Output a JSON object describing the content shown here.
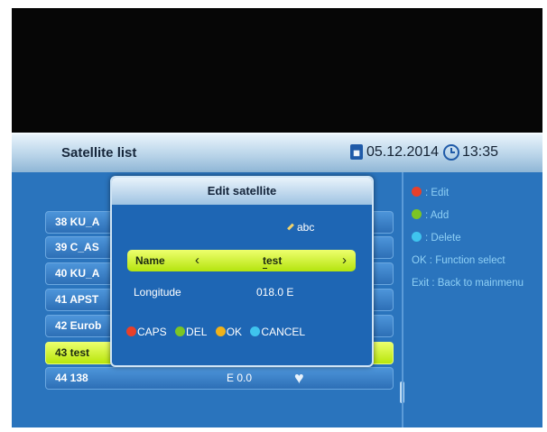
{
  "header": {
    "title": "Satellite list",
    "date": "05.12.2014",
    "time": "13:35"
  },
  "satellite_list": {
    "rows": [
      {
        "label": "38 KU_A",
        "position": ""
      },
      {
        "label": "39 C_AS",
        "position": ""
      },
      {
        "label": "40 KU_A",
        "position": ""
      },
      {
        "label": "41 APST",
        "position": ""
      },
      {
        "label": "42 Eurob",
        "position": ""
      },
      {
        "label": "43 test",
        "position": ""
      },
      {
        "label": "44 138",
        "position": "E 0.0"
      }
    ],
    "selected_index": 5
  },
  "help": {
    "edit": ": Edit",
    "add": ": Add",
    "delete": ": Delete",
    "ok": "OK  : Function select",
    "exit": "Exit  : Back to mainmenu"
  },
  "dialog": {
    "title": "Edit satellite",
    "input_mode": "abc",
    "name_label": "Name",
    "name_value": "test",
    "longitude_label": "Longitude",
    "longitude_value": "018.0 E",
    "keys": {
      "caps": "CAPS",
      "del": "DEL",
      "ok": "OK",
      "cancel": "CANCEL"
    }
  },
  "colors": {
    "red": "#e8402a",
    "green": "#7cc524",
    "yellow": "#f0b21a",
    "cyan": "#3fc4ee",
    "highlight": "#c8f02a",
    "panel_blue": "#2a74bd"
  }
}
